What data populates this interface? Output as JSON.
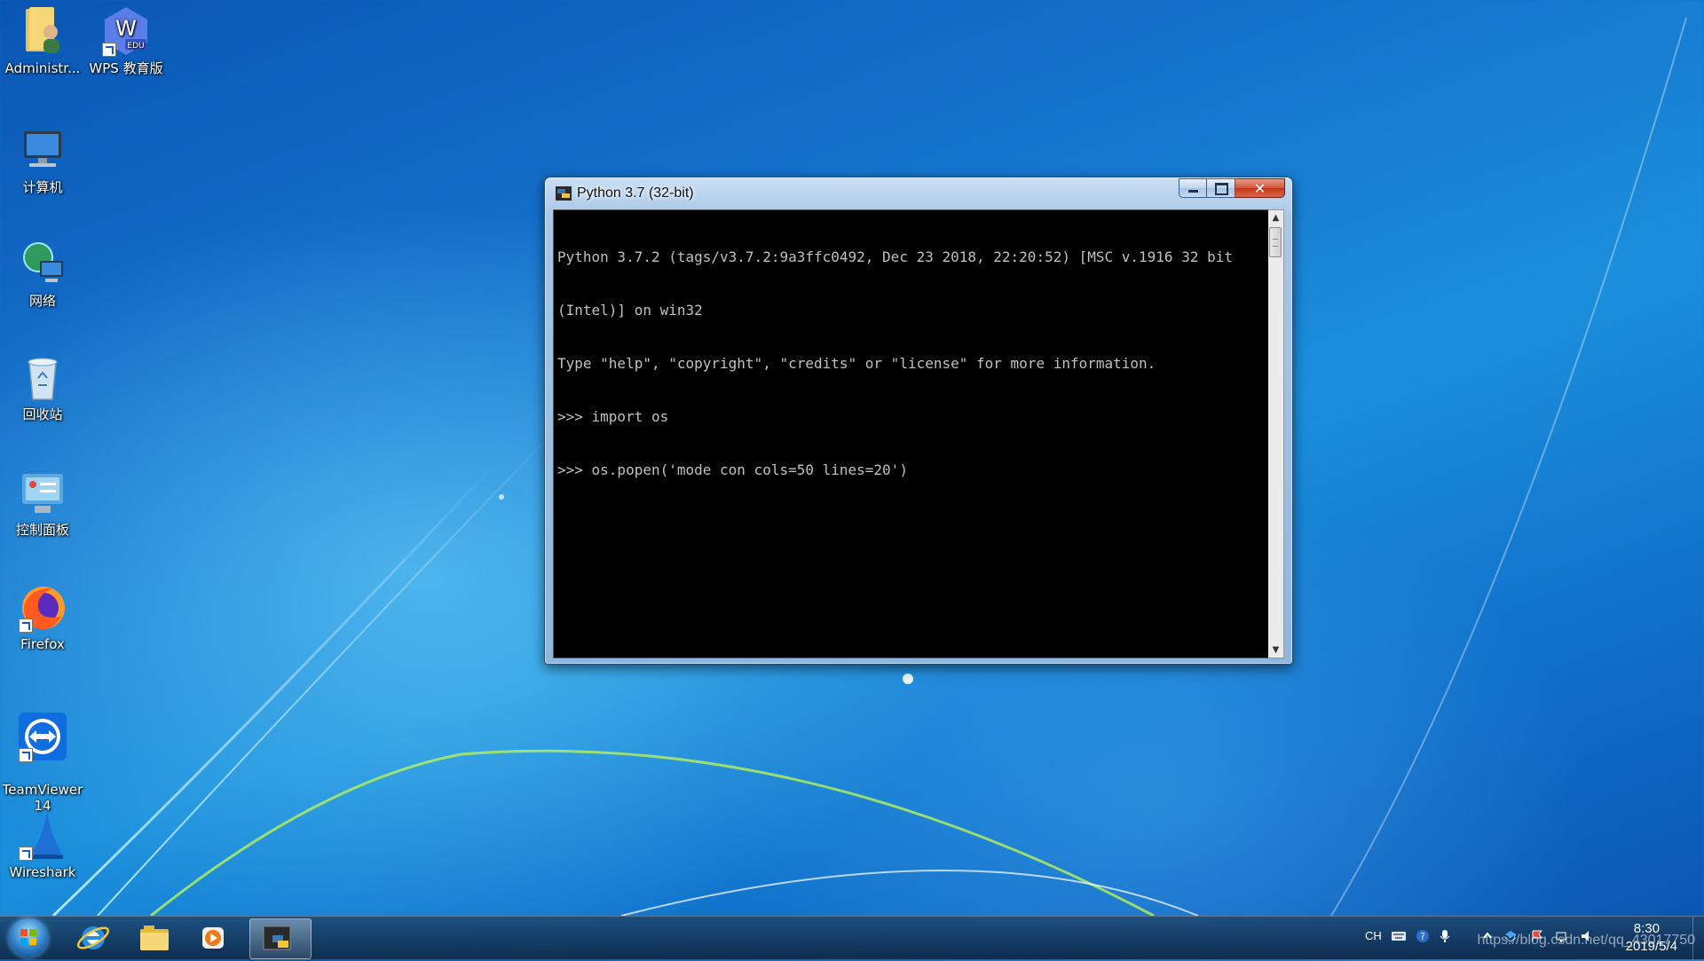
{
  "desktop": {
    "icons": [
      {
        "label": "Administr...",
        "icon": "user-folder-icon"
      },
      {
        "label": "WPS 教育版",
        "icon": "wps-edu-icon"
      },
      {
        "label": "计算机",
        "icon": "computer-icon"
      },
      {
        "label": "网络",
        "icon": "network-icon"
      },
      {
        "label": "回收站",
        "icon": "recycle-bin-icon"
      },
      {
        "label": "控制面板",
        "icon": "control-panel-icon"
      },
      {
        "label": "Firefox",
        "icon": "firefox-icon"
      },
      {
        "label": "TeamViewer\n14",
        "icon": "teamviewer-icon"
      },
      {
        "label": "Wireshark",
        "icon": "wireshark-icon"
      }
    ]
  },
  "window": {
    "title": "Python 3.7 (32-bit)",
    "close_glyph": "✕",
    "console_lines": [
      "Python 3.7.2 (tags/v3.7.2:9a3ffc0492, Dec 23 2018, 22:20:52) [MSC v.1916 32 bit",
      "(Intel)] on win32",
      "Type \"help\", \"copyright\", \"credits\" or \"license\" for more information.",
      ">>> import os",
      ">>> os.popen('mode con cols=50 lines=20')"
    ],
    "scroll_arrows": {
      "up": "▲",
      "down": "▼"
    }
  },
  "taskbar": {
    "pinned": [
      "internet-explorer-icon",
      "file-explorer-icon",
      "media-player-icon",
      "python-console-icon"
    ],
    "tray": {
      "language": "CH",
      "time": "8:30",
      "date": "2019/5/4",
      "watermark": "https://blog.csdn.net/qq_43017750"
    }
  },
  "colors": {
    "console_bg": "#000000",
    "console_fg": "#c0c0c0",
    "close_button": "#c7432a"
  }
}
